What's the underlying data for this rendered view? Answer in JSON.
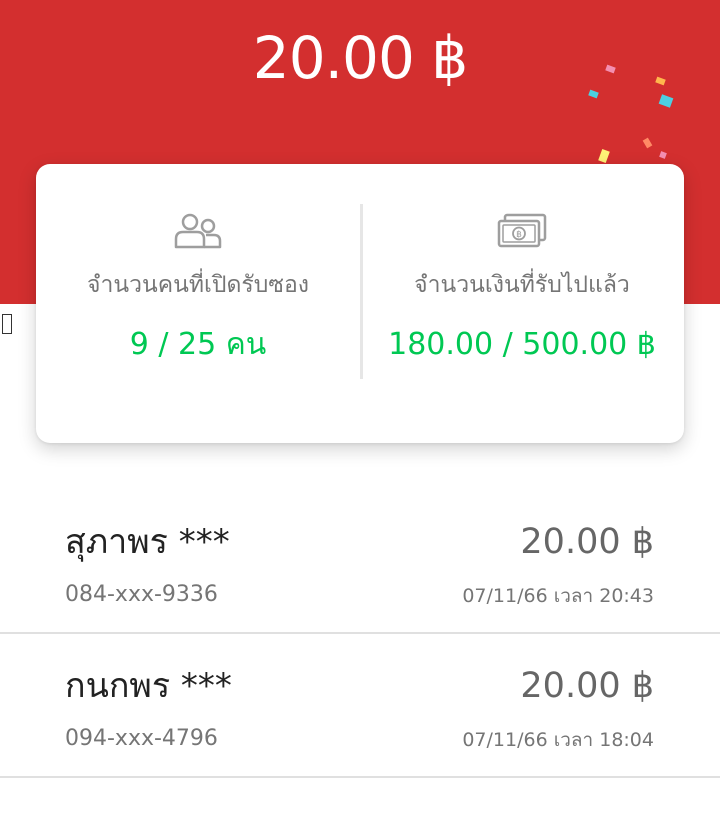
{
  "header": {
    "amount": "20.00 ฿"
  },
  "colors": {
    "header_bg": "#d32f2f",
    "accent_green": "#00c853"
  },
  "stats": {
    "opened": {
      "icon": "people-icon",
      "label": "จำนวนคนที่เปิดรับซอง",
      "value": "9 / 25 คน"
    },
    "received": {
      "icon": "banknote-icon",
      "label": "จำนวนเงินที่รับไปแล้ว",
      "value": "180.00 / 500.00 ฿"
    }
  },
  "recipients": [
    {
      "name": "สุภาพร ***",
      "amount": "20.00 ฿",
      "phone": "084-xxx-9336",
      "time": "07/11/66 เวลา 20:43"
    },
    {
      "name": "กนกพร ***",
      "amount": "20.00 ฿",
      "phone": "094-xxx-4796",
      "time": "07/11/66 เวลา 18:04"
    }
  ]
}
